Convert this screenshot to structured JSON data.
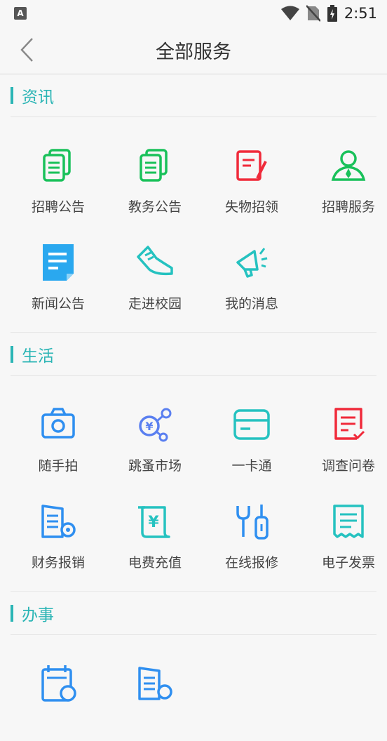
{
  "status": {
    "time": "2:51",
    "notification_icon": "a-notification-icon",
    "icons": [
      "wifi-icon",
      "no-sim-icon",
      "battery-charging-icon"
    ]
  },
  "header": {
    "title": "全部服务",
    "back_icon": "chevron-left-icon"
  },
  "sections": [
    {
      "title": "资讯",
      "items": [
        {
          "label": "招聘公告",
          "icon": "document-stack-icon",
          "color": "#19c15a"
        },
        {
          "label": "教务公告",
          "icon": "document-stack-icon",
          "color": "#19c15a"
        },
        {
          "label": "失物招领",
          "icon": "notepad-pen-icon",
          "color": "#f02a3a"
        },
        {
          "label": "招聘服务",
          "icon": "person-tie-icon",
          "color": "#19c15a"
        },
        {
          "label": "新闻公告",
          "icon": "news-card-icon",
          "color": "#2aa8ef"
        },
        {
          "label": "走进校园",
          "icon": "sneaker-icon",
          "color": "#25c2c0"
        },
        {
          "label": "我的消息",
          "icon": "megaphone-icon",
          "color": "#25c2c0"
        }
      ]
    },
    {
      "title": "生活",
      "items": [
        {
          "label": "随手拍",
          "icon": "camera-icon",
          "color": "#2f8ff0"
        },
        {
          "label": "跳蚤市场",
          "icon": "yuan-share-icon",
          "color": "#5a7ff0"
        },
        {
          "label": "一卡通",
          "icon": "card-icon",
          "color": "#25c2c0"
        },
        {
          "label": "调查问卷",
          "icon": "survey-check-icon",
          "color": "#f02a3a"
        },
        {
          "label": "财务报销",
          "icon": "building-gear-icon",
          "color": "#2f8ff0"
        },
        {
          "label": "电费充值",
          "icon": "yuan-scroll-icon",
          "color": "#25c2c0"
        },
        {
          "label": "在线报修",
          "icon": "wrench-tool-icon",
          "color": "#2f8ff0"
        },
        {
          "label": "电子发票",
          "icon": "receipt-icon",
          "color": "#25c2c0"
        }
      ]
    },
    {
      "title": "办事",
      "items": [
        {
          "label": "",
          "icon": "calendar-clock-icon",
          "color": "#2f8ff0"
        },
        {
          "label": "",
          "icon": "building-gear-icon",
          "color": "#2f8ff0"
        }
      ]
    }
  ]
}
